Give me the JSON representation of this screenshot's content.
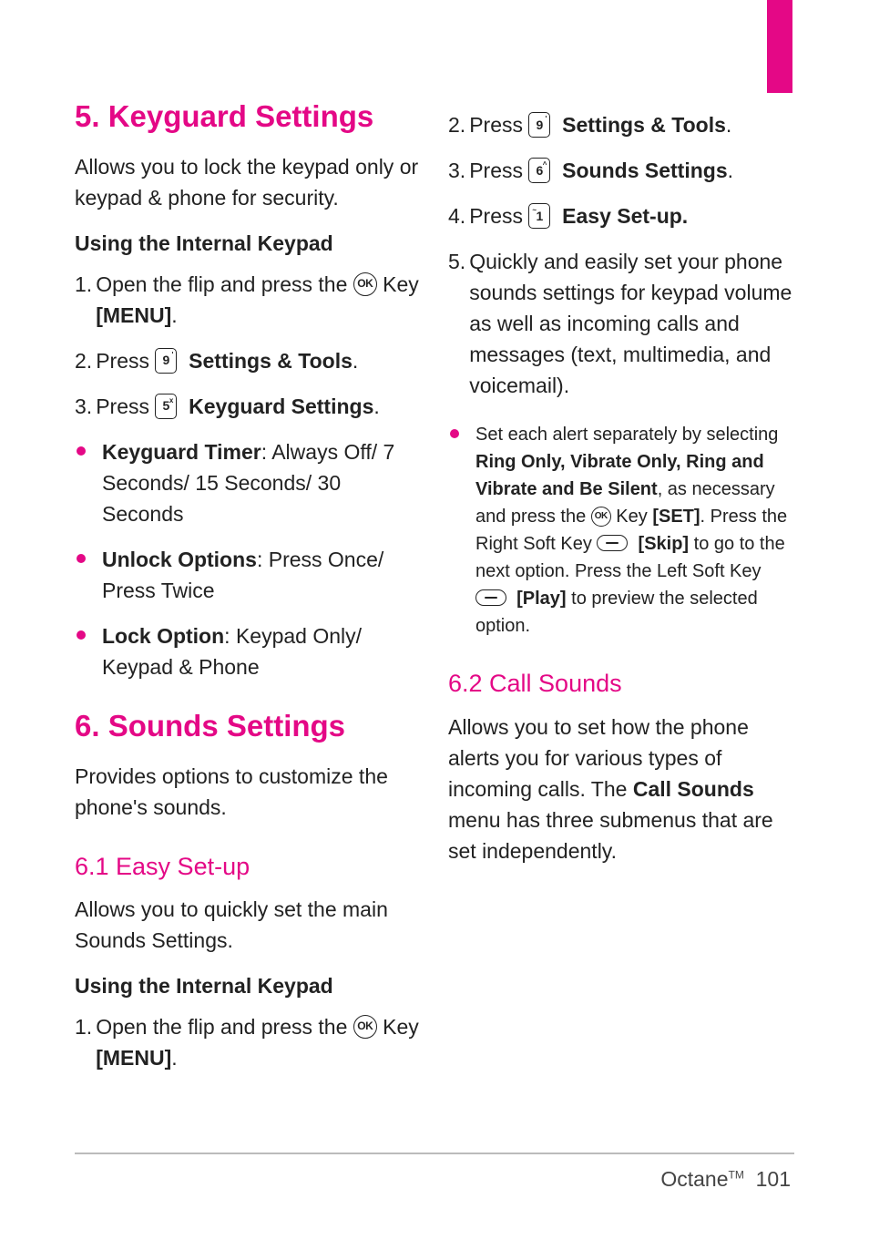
{
  "left": {
    "h1_5": "5. Keyguard Settings",
    "p5": "Allows you to lock the keypad only or keypad & phone for security.",
    "sh1": "Using the Internal Keypad",
    "s1a": "1. ",
    "s1b_1": "Open the flip and press the ",
    "s1b_2": " Key ",
    "s1b_3": "[MENU]",
    "s1b_4": ".",
    "s2a": "2. ",
    "s2b_1": "Press  ",
    "s2b_2": "Settings & Tools",
    "s2b_3": ".",
    "s3a": "3. ",
    "s3b_1": "Press  ",
    "s3b_2": "Keyguard Settings",
    "s3b_3": ".",
    "li1_b": "Keyguard Timer",
    "li1_r": ": Always Off/ 7 Seconds/ 15 Seconds/ 30 Seconds",
    "li2_b": "Unlock Options",
    "li2_r": ": Press Once/ Press Twice",
    "li3_b": "Lock Option",
    "li3_r": ": Keypad Only/ Keypad & Phone",
    "h1_6": "6. Sounds Settings",
    "p6": "Provides options to customize the phone's sounds.",
    "h2_61": "6.1 Easy Set-up",
    "p61": "Allows you to quickly set the main Sounds Settings.",
    "sh2": "Using the Internal Keypad",
    "s61_1a": "1. ",
    "s61_1b_1": "Open the flip and press the ",
    "s61_1b_2": " Key ",
    "s61_1b_3": "[MENU]",
    "s61_1b_4": "."
  },
  "right": {
    "s2a": "2. ",
    "s2b_1": "Press  ",
    "s2b_2": "Settings & Tools",
    "s2b_3": ".",
    "s3a": "3. ",
    "s3b_1": "Press  ",
    "s3b_2": "Sounds Settings",
    "s3b_3": ".",
    "s4a": "4. ",
    "s4b_1": "Press  ",
    "s4b_2": "Easy Set-up.",
    "s5a": "5. ",
    "s5b": "Quickly and easily set your phone sounds settings for keypad volume as well as incoming calls and messages (text, multimedia, and  voicemail).",
    "li_1": "Set each alert separately by selecting ",
    "li_2": "Ring Only, Vibrate Only, Ring and Vibrate and Be Silent",
    "li_3": ", as necessary and press the  ",
    "li_4": " Key ",
    "li_5": "[SET]",
    "li_6": ". Press the Right Soft Key  ",
    "li_7": "[Skip]",
    "li_8": " to go to the next option. Press the Left Soft Key  ",
    "li_9": "[Play]",
    "li_10": " to preview the selected option.",
    "h2_62": "6.2 Call Sounds",
    "p62_1": "Allows you to set how the phone alerts you for various types of incoming calls. The ",
    "p62_b": "Call Sounds",
    "p62_2": " menu has three submenus that are set independently."
  },
  "keys": {
    "ok": "OK",
    "k9": "9",
    "k5": "5",
    "k6": "6",
    "k1": "1",
    "sup_quote": "'",
    "sup_x": "x",
    "sup_hat": "^",
    "sup_tilde": "~"
  },
  "footer": {
    "name": "Octane",
    "tm": "TM",
    "page": "101"
  }
}
